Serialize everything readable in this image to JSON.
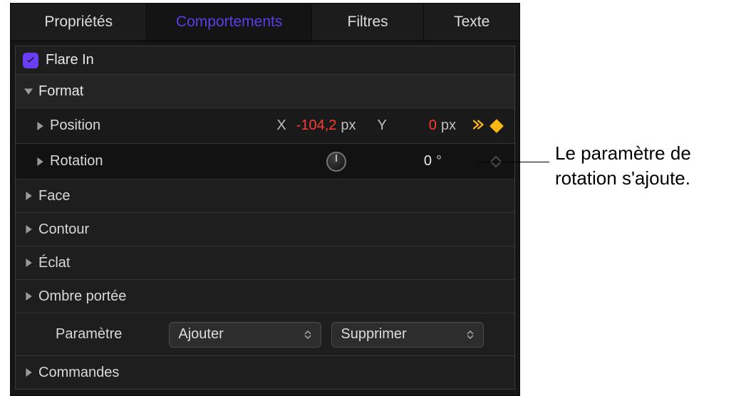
{
  "tabs": {
    "properties": "Propriétés",
    "behaviors": "Comportements",
    "filters": "Filtres",
    "text": "Texte"
  },
  "behavior": {
    "title": "Flare In"
  },
  "sections": {
    "format": "Format",
    "position": {
      "label": "Position",
      "x_label": "X",
      "x_value": "-104,2",
      "x_unit": "px",
      "y_label": "Y",
      "y_value": "0",
      "y_unit": "px"
    },
    "rotation": {
      "label": "Rotation",
      "value": "0",
      "unit": "°"
    },
    "face": "Face",
    "outline": "Contour",
    "glow": "Éclat",
    "shadow": "Ombre portée",
    "parameter": {
      "label": "Paramètre",
      "add": "Ajouter",
      "remove": "Supprimer"
    },
    "commands": "Commandes"
  },
  "annotation": {
    "text_line1": "Le paramètre de",
    "text_line2": "rotation s'ajoute."
  }
}
